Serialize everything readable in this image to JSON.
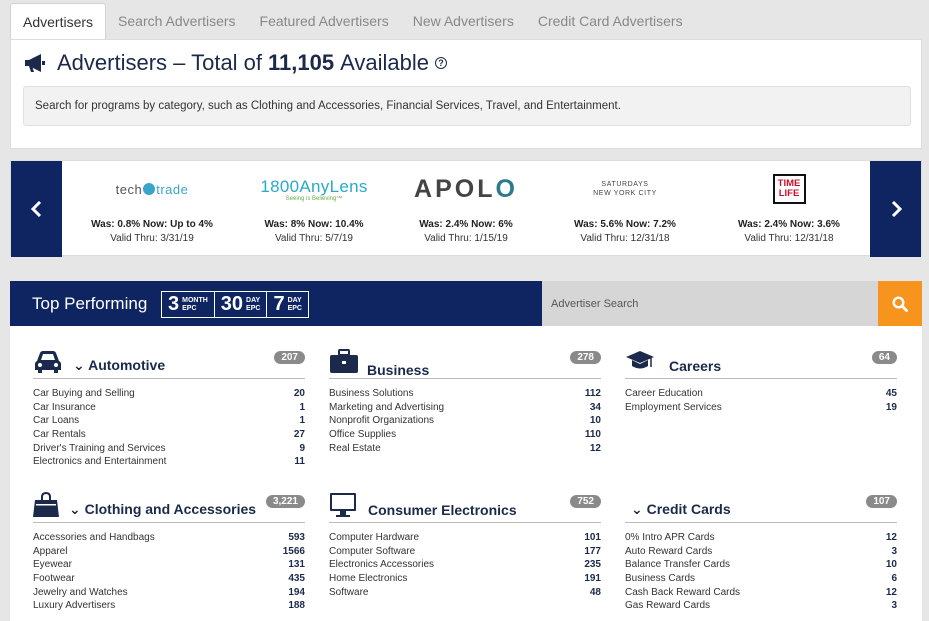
{
  "tabs": [
    "Advertisers",
    "Search Advertisers",
    "Featured Advertisers",
    "New Advertisers",
    "Credit Card Advertisers"
  ],
  "header": {
    "title_prefix": "Advertisers – Total of",
    "title_count": "11,105",
    "title_suffix": "Available",
    "help": "?",
    "hint": "Search for programs by category, such as Clothing and Accessories, Financial Services, Travel, and Entertainment."
  },
  "carousel": [
    {
      "logo": "techtrade",
      "logo_text_a": "tech",
      "logo_text_b": "trade",
      "offer": "Was: 0.8% Now: Up to 4%",
      "valid": "Valid Thru: 3/31/19"
    },
    {
      "logo": "1800anylens",
      "logo_text_a": "1800AnyLens",
      "logo_text_b": "Seeing is Believing™",
      "offer": "Was: 8% Now: 10.4%",
      "valid": "Valid Thru: 5/7/19"
    },
    {
      "logo": "apollo",
      "logo_text_a": "APOL",
      "logo_text_b": "O",
      "offer": "Was: 2.4% Now: 6%",
      "valid": "Valid Thru: 1/15/19"
    },
    {
      "logo": "saturdays",
      "logo_text_a": "SATURDAYS",
      "logo_text_b": "NEW YORK CITY",
      "offer": "Was: 5.6% Now: 7.2%",
      "valid": "Valid Thru: 12/31/18"
    },
    {
      "logo": "timelife",
      "logo_text_a": "TIME",
      "logo_text_b": "LIFE",
      "offer": "Was: 2.4% Now: 3.6%",
      "valid": "Valid Thru: 12/31/18"
    }
  ],
  "top_performing": {
    "title": "Top Performing",
    "epc_options": [
      {
        "num": "3",
        "unit": "MONTH",
        "epc": "EPC"
      },
      {
        "num": "30",
        "unit": "DAY",
        "epc": "EPC"
      },
      {
        "num": "7",
        "unit": "DAY",
        "epc": "EPC"
      }
    ],
    "search_placeholder": "Advertiser Search"
  },
  "categories": [
    {
      "name": "Automotive",
      "count": "207",
      "icon": "car-icon",
      "chevron": true,
      "items": [
        [
          "Car Buying and Selling",
          "20"
        ],
        [
          "Car Insurance",
          "1"
        ],
        [
          "Car Loans",
          "1"
        ],
        [
          "Car Rentals",
          "27"
        ],
        [
          "Driver's Training and Services",
          "9"
        ],
        [
          "Electronics and Entertainment",
          "11"
        ]
      ]
    },
    {
      "name": "Business",
      "count": "278",
      "icon": "briefcase-icon",
      "chevron": false,
      "items": [
        [
          "Business Solutions",
          "112"
        ],
        [
          "Marketing and Advertising",
          "34"
        ],
        [
          "Nonprofit Organizations",
          "10"
        ],
        [
          "Office Supplies",
          "110"
        ],
        [
          "Real Estate",
          "12"
        ]
      ]
    },
    {
      "name": "Careers",
      "count": "64",
      "icon": "graduation-cap-icon",
      "chevron": false,
      "items": [
        [
          "Career Education",
          "45"
        ],
        [
          "Employment Services",
          "19"
        ]
      ]
    },
    {
      "name": "Clothing and Accessories",
      "count": "3,221",
      "icon": "shopping-bag-icon",
      "chevron": true,
      "items": [
        [
          "Accessories and Handbags",
          "593"
        ],
        [
          "Apparel",
          "1566"
        ],
        [
          "Eyewear",
          "131"
        ],
        [
          "Footwear",
          "435"
        ],
        [
          "Jewelry and Watches",
          "194"
        ],
        [
          "Luxury Advertisers",
          "188"
        ]
      ]
    },
    {
      "name": "Consumer Electronics",
      "count": "752",
      "icon": "monitor-icon",
      "chevron": false,
      "items": [
        [
          "Computer Hardware",
          "101"
        ],
        [
          "Computer Software",
          "177"
        ],
        [
          "Electronics Accessories",
          "235"
        ],
        [
          "Home Electronics",
          "191"
        ],
        [
          "Software",
          "48"
        ]
      ]
    },
    {
      "name": "Credit Cards",
      "count": "107",
      "icon": "none",
      "chevron": true,
      "items": [
        [
          "0% Intro APR Cards",
          "12"
        ],
        [
          "Auto Reward Cards",
          "3"
        ],
        [
          "Balance Transfer Cards",
          "10"
        ],
        [
          "Business Cards",
          "6"
        ],
        [
          "Cash Back Reward Cards",
          "12"
        ],
        [
          "Gas Reward Cards",
          "3"
        ]
      ]
    }
  ]
}
